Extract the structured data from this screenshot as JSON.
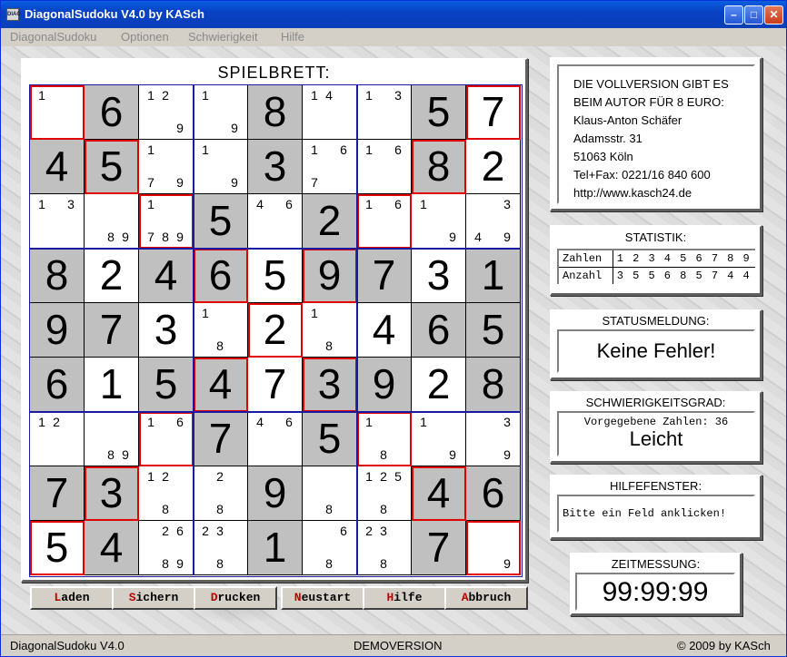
{
  "window": {
    "title": "DiagonalSudoku V4.0 by KASch",
    "icon_text": "DIAG",
    "min": "–",
    "max": "□",
    "close": "✕"
  },
  "menu": [
    "DiagonalSudoku",
    "Optionen",
    "Schwierigkeit",
    "Hilfe"
  ],
  "board": {
    "title": "SPIELBRETT:",
    "cells": [
      [
        {
          "c": "1"
        },
        {
          "v": "6",
          "g": 1
        },
        {
          "c": "1 2 _ _ _ 9"
        },
        {
          "c": "1 _ _ _ _ 9"
        },
        {
          "v": "8",
          "g": 1
        },
        {
          "c": "1 4 _ _ _ _"
        },
        {
          "c": "1 _ 3 _ _ _"
        },
        {
          "v": "5",
          "g": 1
        },
        {
          "v": "7"
        }
      ],
      [
        {
          "v": "4",
          "g": 1
        },
        {
          "v": "5",
          "g": 1
        },
        {
          "c": "1 _ _ 7 _ 9"
        },
        {
          "c": "1 _ _ _ _ 9"
        },
        {
          "v": "3",
          "g": 1
        },
        {
          "c": "1 _ 6 7 _ _"
        },
        {
          "c": "1 _ 6 _ _ _"
        },
        {
          "v": "8",
          "g": 1
        },
        {
          "v": "2"
        }
      ],
      [
        {
          "c": "1 _ 3 _ _ _"
        },
        {
          "c": "_ _ _ _ 8 9"
        },
        {
          "c": "1 _ _ 7 8 9"
        },
        {
          "v": "5",
          "g": 1
        },
        {
          "c": "4 _ 6 _ _ _"
        },
        {
          "v": "2",
          "g": 1
        },
        {
          "c": "1 _ 6 _ _ _"
        },
        {
          "c": "1 _ _ _ _ 9"
        },
        {
          "c": "_ _ 3 4 _ 9"
        }
      ],
      [
        {
          "v": "8",
          "g": 1
        },
        {
          "v": "2"
        },
        {
          "v": "4",
          "g": 1
        },
        {
          "v": "6",
          "g": 1
        },
        {
          "v": "5"
        },
        {
          "v": "9",
          "g": 1
        },
        {
          "v": "7",
          "g": 1
        },
        {
          "v": "3"
        },
        {
          "v": "1",
          "g": 1
        }
      ],
      [
        {
          "v": "9",
          "g": 1
        },
        {
          "v": "7",
          "g": 1
        },
        {
          "v": "3"
        },
        {
          "c": "1 _ _ _ 8 _"
        },
        {
          "v": "2"
        },
        {
          "c": "1 _ _ _ 8 _"
        },
        {
          "v": "4"
        },
        {
          "v": "6",
          "g": 1
        },
        {
          "v": "5",
          "g": 1
        }
      ],
      [
        {
          "v": "6",
          "g": 1
        },
        {
          "v": "1"
        },
        {
          "v": "5",
          "g": 1
        },
        {
          "v": "4",
          "g": 1
        },
        {
          "v": "7"
        },
        {
          "v": "3",
          "g": 1
        },
        {
          "v": "9",
          "g": 1
        },
        {
          "v": "2"
        },
        {
          "v": "8",
          "g": 1
        }
      ],
      [
        {
          "c": "1 2 _ _ _ _"
        },
        {
          "c": "_ _ _ _ 8 9"
        },
        {
          "c": "1 _ 6 _ _ _"
        },
        {
          "v": "7",
          "g": 1
        },
        {
          "c": "4 _ 6 _ _ _"
        },
        {
          "v": "5",
          "g": 1
        },
        {
          "c": "1 _ _ _ 8 _"
        },
        {
          "c": "1 _ _ _ _ 9"
        },
        {
          "c": "_ _ 3 _ _ 9"
        }
      ],
      [
        {
          "v": "7",
          "g": 1
        },
        {
          "v": "3",
          "g": 1
        },
        {
          "c": "1 2 _ _ 8 _"
        },
        {
          "c": "_ 2 _ _ 8 _"
        },
        {
          "v": "9",
          "g": 1
        },
        {
          "c": "_ _ _ _ 8 _"
        },
        {
          "c": "1 2 5 _ 8 _"
        },
        {
          "v": "4",
          "g": 1
        },
        {
          "v": "6",
          "g": 1
        }
      ],
      [
        {
          "v": "5"
        },
        {
          "v": "4",
          "g": 1
        },
        {
          "c": "_ 2 6 _ 8 9"
        },
        {
          "c": "2 3 _ _ 8 _"
        },
        {
          "v": "1",
          "g": 1
        },
        {
          "c": "_ _ 6 _ 8 _"
        },
        {
          "c": "2 3 _ _ 8 _"
        },
        {
          "v": "7",
          "g": 1
        },
        {
          "c": "_ _ _ _ _ 9"
        }
      ]
    ]
  },
  "buttons": [
    {
      "hk": "L",
      "rest": "aden"
    },
    {
      "hk": "S",
      "rest": "ichern"
    },
    {
      "hk": "D",
      "rest": "rucken"
    },
    {
      "hk": "N",
      "rest": "eustart"
    },
    {
      "hk": "H",
      "rest": "ilfe"
    },
    {
      "hk": "A",
      "rest": "bbruch"
    }
  ],
  "promo": {
    "lines": [
      "DIE VOLLVERSION GIBT ES",
      "BEIM AUTOR FÜR 8 EURO:",
      "Klaus-Anton Schäfer",
      "Adamsstr. 31",
      "51063 Köln",
      "Tel+Fax: 0221/16 840 600",
      "http://www.kasch24.de"
    ]
  },
  "statistics": {
    "title": "STATISTIK:",
    "row1_label": "Zahlen",
    "row2_label": "Anzahl",
    "numbers": [
      "1",
      "2",
      "3",
      "4",
      "5",
      "6",
      "7",
      "8",
      "9"
    ],
    "counts": [
      "3",
      "5",
      "5",
      "6",
      "8",
      "5",
      "7",
      "4",
      "4"
    ]
  },
  "status": {
    "title": "STATUSMELDUNG:",
    "message": "Keine Fehler!"
  },
  "difficulty": {
    "title": "SCHWIERIGKEITSGRAD:",
    "given": "Vorgegebene Zahlen: 36",
    "level": "Leicht"
  },
  "help": {
    "title": "HILFEFENSTER:",
    "message": "Bitte ein Feld anklicken!"
  },
  "timer": {
    "title": "ZEITMESSUNG:",
    "value": "99:99:99"
  },
  "statusbar": {
    "left": "DiagonalSudoku V4.0",
    "center": "DEMOVERSION",
    "right": "© 2009 by KASch"
  }
}
